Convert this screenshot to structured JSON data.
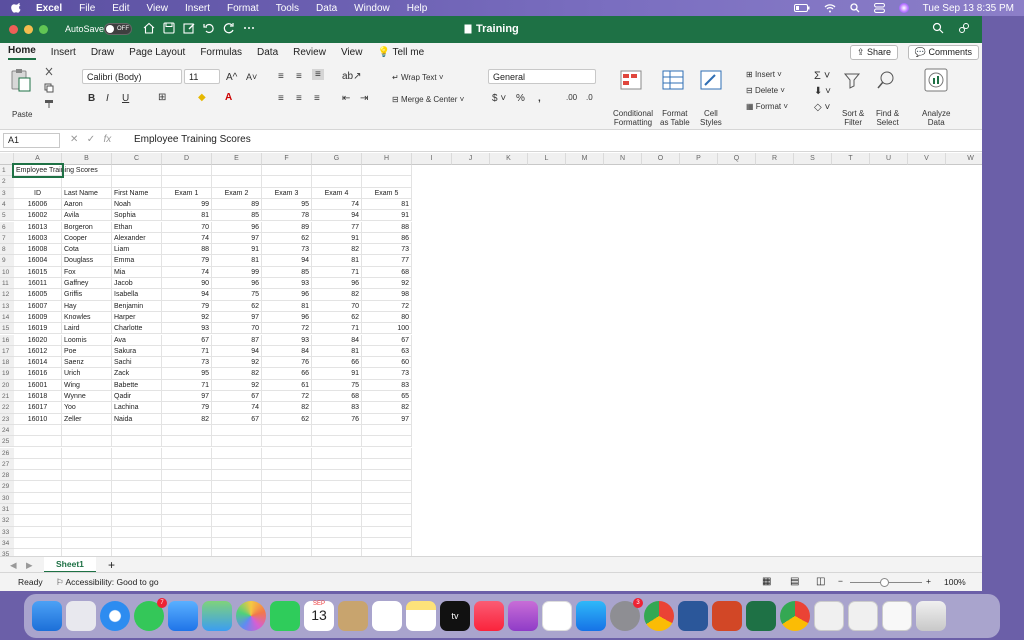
{
  "menubar": {
    "app": "Excel",
    "items": [
      "File",
      "Edit",
      "View",
      "Insert",
      "Format",
      "Tools",
      "Data",
      "Window",
      "Help"
    ],
    "datetime": "Tue Sep 13  8:35 PM"
  },
  "titlebar": {
    "autosave_label": "AutoSave",
    "autosave_state": "OFF",
    "doc_title": "Training"
  },
  "tabs": [
    "Home",
    "Insert",
    "Draw",
    "Page Layout",
    "Formulas",
    "Data",
    "Review",
    "View",
    "Tell me"
  ],
  "share_label": "Share",
  "comments_label": "Comments",
  "ribbon": {
    "paste": "Paste",
    "font_name": "Calibri (Body)",
    "font_size": "11",
    "wrap_text": "Wrap Text",
    "merge_center": "Merge & Center",
    "number_format": "General",
    "conditional": [
      "Conditional",
      "Formatting"
    ],
    "format_table": [
      "Format",
      "as Table"
    ],
    "cell_styles": [
      "Cell",
      "Styles"
    ],
    "insert": "Insert",
    "delete": "Delete",
    "format": "Format",
    "sort_filter": [
      "Sort &",
      "Filter"
    ],
    "find_select": [
      "Find &",
      "Select"
    ],
    "analyze": [
      "Analyze",
      "Data"
    ]
  },
  "formula_bar": {
    "name_box": "A1",
    "fx": "fx",
    "content": "Employee Training Scores"
  },
  "columns": [
    "A",
    "B",
    "C",
    "D",
    "E",
    "F",
    "G",
    "H",
    "I",
    "J",
    "K",
    "L",
    "M",
    "N",
    "O",
    "P",
    "Q",
    "R",
    "S",
    "T",
    "U",
    "V",
    "W"
  ],
  "sheet": {
    "title": "Employee Training Scores",
    "headers": [
      "ID",
      "Last Name",
      "First Name",
      "Exam 1",
      "Exam 2",
      "Exam 3",
      "Exam 4",
      "Exam 5"
    ],
    "rows": [
      [
        "16006",
        "Aaron",
        "Noah",
        "99",
        "89",
        "95",
        "74",
        "81"
      ],
      [
        "16002",
        "Avila",
        "Sophia",
        "81",
        "85",
        "78",
        "94",
        "91"
      ],
      [
        "16013",
        "Borgeron",
        "Ethan",
        "70",
        "96",
        "89",
        "77",
        "88"
      ],
      [
        "16003",
        "Cooper",
        "Alexander",
        "74",
        "97",
        "62",
        "91",
        "86"
      ],
      [
        "16008",
        "Cota",
        "Liam",
        "88",
        "91",
        "73",
        "82",
        "73"
      ],
      [
        "16004",
        "Douglass",
        "Emma",
        "79",
        "81",
        "94",
        "81",
        "77"
      ],
      [
        "16015",
        "Fox",
        "Mia",
        "74",
        "99",
        "85",
        "71",
        "68"
      ],
      [
        "16011",
        "Gaffney",
        "Jacob",
        "90",
        "96",
        "93",
        "96",
        "92"
      ],
      [
        "16005",
        "Griffis",
        "Isabella",
        "94",
        "75",
        "96",
        "82",
        "98"
      ],
      [
        "16007",
        "Hay",
        "Benjamin",
        "79",
        "62",
        "81",
        "70",
        "72"
      ],
      [
        "16009",
        "Knowles",
        "Harper",
        "92",
        "97",
        "96",
        "62",
        "80"
      ],
      [
        "16019",
        "Laird",
        "Charlotte",
        "93",
        "70",
        "72",
        "71",
        "100"
      ],
      [
        "16020",
        "Loomis",
        "Ava",
        "67",
        "87",
        "93",
        "84",
        "67"
      ],
      [
        "16012",
        "Poe",
        "Sakura",
        "71",
        "94",
        "84",
        "81",
        "63"
      ],
      [
        "16014",
        "Saenz",
        "Sachi",
        "73",
        "92",
        "76",
        "66",
        "60"
      ],
      [
        "16016",
        "Urich",
        "Zack",
        "95",
        "82",
        "66",
        "91",
        "73"
      ],
      [
        "16001",
        "Wing",
        "Babette",
        "71",
        "92",
        "61",
        "75",
        "83"
      ],
      [
        "16018",
        "Wynne",
        "Qadir",
        "97",
        "67",
        "72",
        "68",
        "65"
      ],
      [
        "16017",
        "Yoo",
        "Lachina",
        "79",
        "74",
        "82",
        "83",
        "82"
      ],
      [
        "16010",
        "Zeller",
        "Naida",
        "82",
        "67",
        "62",
        "76",
        "97"
      ]
    ]
  },
  "sheet_tab": "Sheet1",
  "status": {
    "ready": "Ready",
    "accessibility": "Accessibility: Good to go",
    "zoom": "100%"
  },
  "dock": {
    "calendar_month": "SEP",
    "calendar_day": "13",
    "messages_badge": "7",
    "settings_badge": "3"
  },
  "colors": {
    "excel_green": "#1e7145",
    "menubar": "#6b5fa8"
  }
}
